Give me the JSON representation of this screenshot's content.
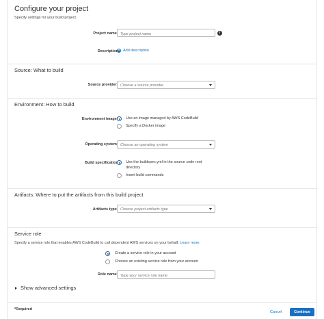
{
  "header": {
    "title": "Configure your project",
    "subtitle": "Specify settings for your build project."
  },
  "project": {
    "name_label": "Project name*",
    "name_placeholder": "Type project name",
    "description_label": "Description",
    "add_description": "Add description"
  },
  "source": {
    "section_title": "Source: What to build",
    "provider_label": "Source provider*",
    "provider_value": "Choose a source provider"
  },
  "environment": {
    "section_title": "Environment: How to build",
    "image_label": "Environment image*",
    "image_options": [
      {
        "label": "Use an image managed by AWS CodeBuild",
        "selected": true
      },
      {
        "label": "Specify a Docker image",
        "selected": false
      }
    ],
    "os_label": "Operating system*",
    "os_value": "Choose an operating system",
    "buildspec_label": "Build specification",
    "buildspec_options": [
      {
        "label": "Use the buildspec.yml in the source code root",
        "label_line2": "directory",
        "selected": true
      },
      {
        "label": "Insert build commands",
        "selected": false
      }
    ]
  },
  "artifacts": {
    "section_title": "Artifacts: Where to put the artifacts from this build project",
    "type_label": "Artifacts type*",
    "type_value": "Choose project artifacts type"
  },
  "service_role": {
    "section_title": "Service role",
    "description": "Specify a service role that enables AWS CodeBuild to call dependent AWS services on your behalf.",
    "learn_more": "Learn more.",
    "options": [
      {
        "label": "Create a service role in your account",
        "selected": true
      },
      {
        "label": "Choose an existing service role from your account",
        "selected": false
      }
    ],
    "role_name_label": "Role name*",
    "role_name_placeholder": "Type your service role name"
  },
  "advanced": {
    "label": "Show advanced settings"
  },
  "footer": {
    "required_note": "*Required",
    "cancel": "Cancel",
    "continue": "Continue"
  },
  "colors": {
    "accent": "#1a6fc0",
    "link": "#1a73b8"
  }
}
